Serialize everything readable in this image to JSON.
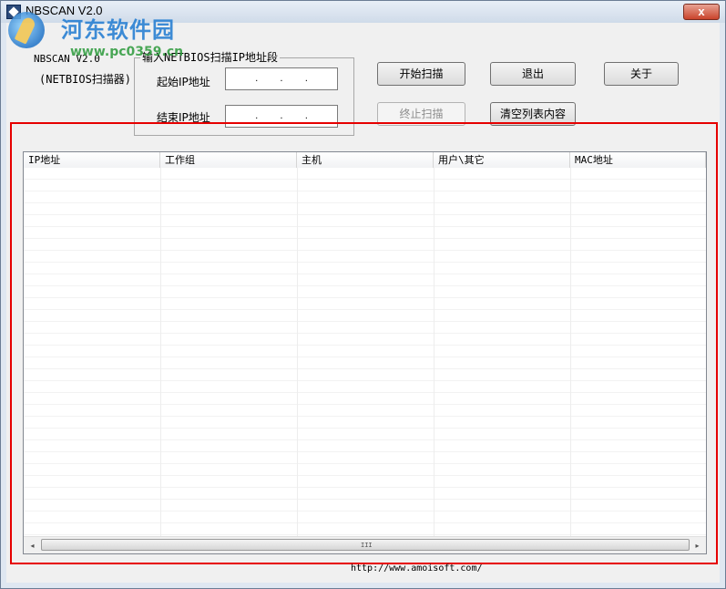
{
  "window": {
    "title": "NBSCAN V2.0",
    "close_glyph": "x"
  },
  "watermark": {
    "text": "河东软件园",
    "url": "www.pc0359.cn"
  },
  "app": {
    "name_line1": "NBSCAN V2.0",
    "name_line2": "(NETBIOS扫描器)"
  },
  "group": {
    "legend": "输入NETBIOS扫描IP地址段",
    "start_label": "起始IP地址",
    "end_label": "结束IP地址",
    "start_value": [
      ".",
      ".",
      "."
    ],
    "end_value": [
      ".",
      ".",
      "."
    ]
  },
  "buttons": {
    "start_scan": "开始扫描",
    "exit": "退出",
    "about": "关于",
    "stop_scan": "终止扫描",
    "clear_list": "清空列表内容"
  },
  "list": {
    "columns": [
      "IP地址",
      "工作组",
      "主机",
      "用户\\其它",
      "MAC地址"
    ],
    "rows": []
  },
  "scrollbar": {
    "left_arrow": "◂",
    "right_arrow": "▸",
    "grip": "III"
  },
  "footer": {
    "url": "http://www.amoisoft.com/"
  },
  "colors": {
    "highlight": "#e60000",
    "close_button": "#c9432b"
  },
  "icons": [
    "app-icon",
    "close-icon",
    "scroll-left-arrow-icon",
    "scroll-right-arrow-icon"
  ]
}
